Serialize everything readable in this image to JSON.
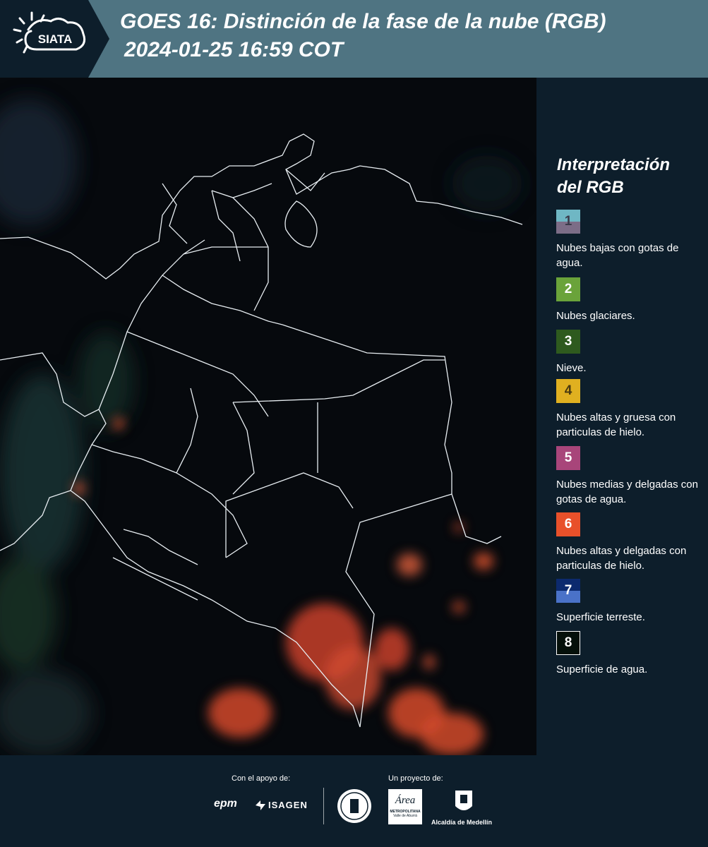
{
  "header": {
    "logo_text": "SIATA",
    "title_line1": "GOES 16: Distinción de la fase de la nube (RGB)",
    "title_line2": "2024-01-25 16:59 COT"
  },
  "legend": {
    "title": "Interpretación del RGB",
    "items": [
      {
        "num": "1",
        "text": "Nubes bajas con gotas de agua.",
        "color_top": "#6fb7c4",
        "color_bottom": "#7c6d87"
      },
      {
        "num": "2",
        "text": "Nubes glaciares.",
        "color": "#6aa33a"
      },
      {
        "num": "3",
        "text": "Nieve.",
        "color": "#2e5a1e"
      },
      {
        "num": "4",
        "text": "Nubes altas y gruesa con particulas de hielo.",
        "color": "#e0b020"
      },
      {
        "num": "5",
        "text": "Nubes medias y delgadas con gotas de agua.",
        "color": "#a8457a"
      },
      {
        "num": "6",
        "text": "Nubes altas y delgadas con particulas de hielo.",
        "color": "#e8502a"
      },
      {
        "num": "7",
        "text": "Superficie terreste.",
        "color_top": "#0c2a6e",
        "color_bottom": "#4a72c8"
      },
      {
        "num": "8",
        "text": "Superficie de agua.",
        "color": "#05100a"
      }
    ]
  },
  "footer": {
    "support_label": "Con el apoyo de:",
    "project_label": "Un proyecto de:",
    "sponsor_epm": "epm",
    "sponsor_isagen": "ISAGEN",
    "sponsor_area_text": "METROPOLITANA",
    "sponsor_area_sub": "Valle de Aburrá",
    "sponsor_area_script": "Área",
    "sponsor_alcaldia": "Alcaldía de Medellín"
  }
}
